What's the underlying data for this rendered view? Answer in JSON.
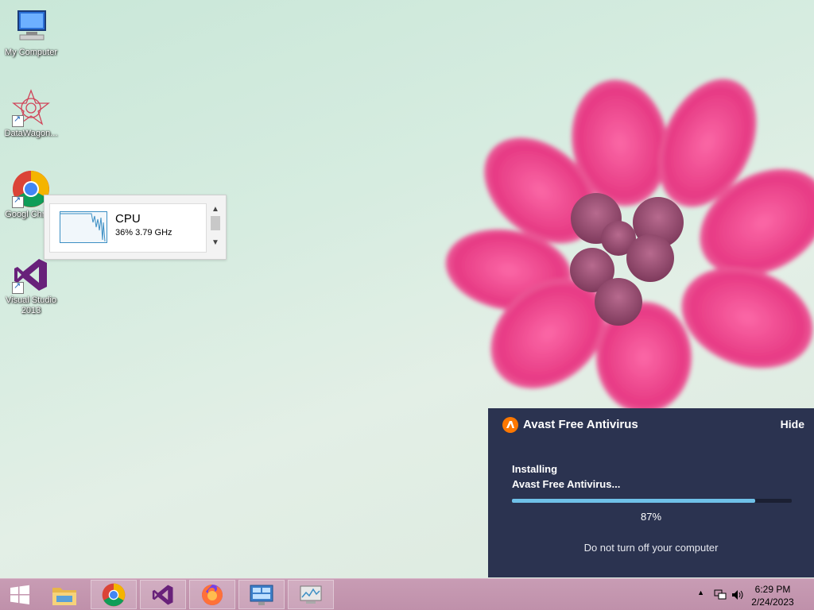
{
  "desktop": {
    "icons": [
      {
        "label": "My Computer"
      },
      {
        "label": "DataWagon..."
      },
      {
        "label": "Googl Chrom"
      },
      {
        "label": "Visual Studio 2013"
      }
    ]
  },
  "cpu_widget": {
    "title": "CPU",
    "value": "36%  3.79 GHz"
  },
  "avast": {
    "title": "Avast Free Antivirus",
    "hide_label": "Hide",
    "status_line1": "Installing",
    "status_line2": "Avast Free Antivirus...",
    "progress_percent": 87,
    "progress_label": "87%",
    "note": "Do not turn off your computer",
    "accent_color": "#ff7800",
    "background_color": "#2b3350"
  },
  "taskbar": {
    "items": [
      {
        "icon": "windows-start-icon"
      },
      {
        "icon": "file-explorer-icon"
      },
      {
        "icon": "chrome-icon"
      },
      {
        "icon": "visual-studio-icon"
      },
      {
        "icon": "firefox-icon"
      },
      {
        "icon": "control-panel-icon"
      },
      {
        "icon": "task-manager-icon"
      }
    ],
    "clock": {
      "time": "6:29 PM",
      "date": "2/24/2023"
    },
    "color": "#c89cb4"
  }
}
